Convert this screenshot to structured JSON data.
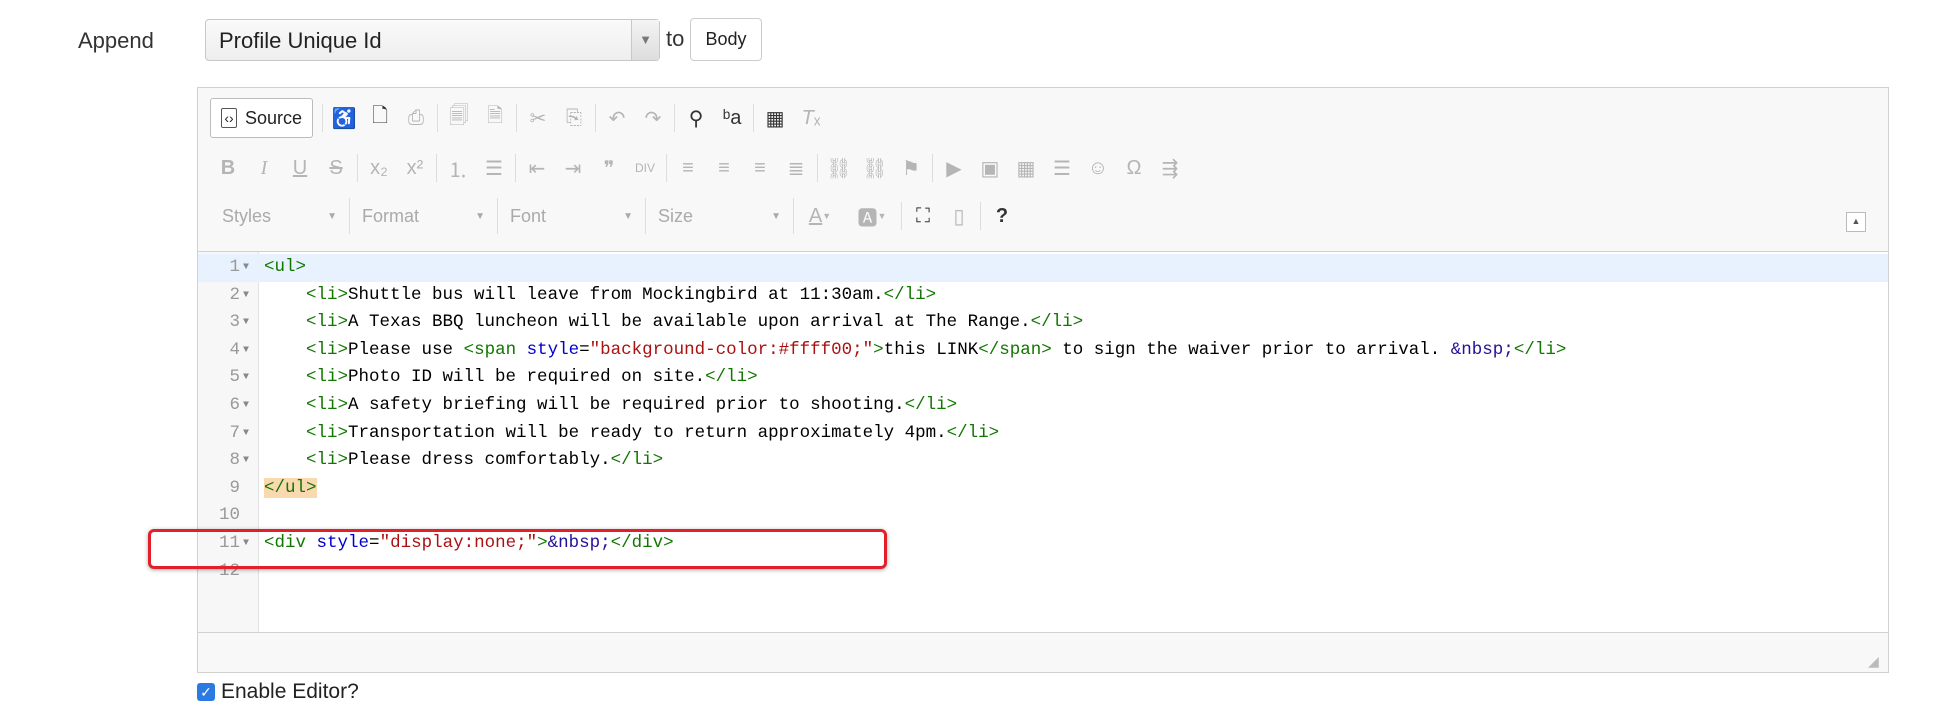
{
  "append": {
    "label": "Append",
    "select_value": "Profile Unique Id",
    "to_label": "to",
    "target_button": "Body"
  },
  "toolbar": {
    "source_label": "Source",
    "styles_label": "Styles",
    "format_label": "Format",
    "font_label": "Font",
    "size_label": "Size",
    "help_label": "?"
  },
  "code_lines": [
    {
      "n": "1",
      "fold": true
    },
    {
      "n": "2",
      "fold": true
    },
    {
      "n": "3",
      "fold": true
    },
    {
      "n": "4",
      "fold": true
    },
    {
      "n": "5",
      "fold": true
    },
    {
      "n": "6",
      "fold": true
    },
    {
      "n": "7",
      "fold": true
    },
    {
      "n": "8",
      "fold": true
    },
    {
      "n": "9",
      "fold": false
    },
    {
      "n": "10",
      "fold": false
    },
    {
      "n": "11",
      "fold": true
    },
    {
      "n": "12",
      "fold": false
    }
  ],
  "code": {
    "l1": "<ul>",
    "l2": [
      "    ",
      "<li>",
      "Shuttle bus will leave from Mockingbird at 11:30am.",
      "</li>"
    ],
    "l3": [
      "    ",
      "<li>",
      "A Texas BBQ luncheon will be available upon arrival at The Range.",
      "</li>"
    ],
    "l4": [
      "    ",
      "<li>",
      "Please use ",
      "<span",
      " ",
      "style",
      "=",
      "\"background-color:#ffff00;\"",
      ">",
      "this LINK",
      "</span>",
      " to sign the waiver prior to arrival. ",
      "&nbsp;",
      "</li>"
    ],
    "l5": [
      "    ",
      "<li>",
      "Photo ID will be required on site.",
      "</li>"
    ],
    "l6": [
      "    ",
      "<li>",
      "A safety briefing will be required prior to shooting.",
      "</li>"
    ],
    "l7": [
      "    ",
      "<li>",
      "Transportation will be ready to return approximately 4pm.",
      "</li>"
    ],
    "l8": [
      "    ",
      "<li>",
      "Please dress comfortably.",
      "</li>"
    ],
    "l9": "</ul>",
    "l11": [
      "<div",
      " ",
      "style",
      "=",
      "\"display:none;\"",
      ">",
      "&nbsp;",
      "</div>"
    ]
  },
  "enable_editor": {
    "label": "Enable Editor?",
    "checked": true
  }
}
